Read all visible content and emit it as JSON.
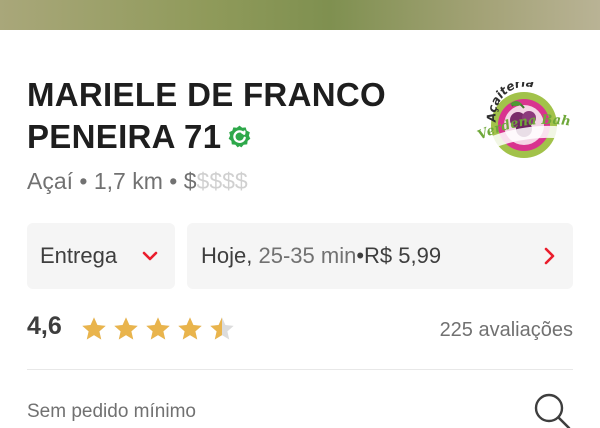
{
  "store": {
    "name_line1": "MARIELE DE FRANCO",
    "name_line2": "PENEIRA 71",
    "category": "Açaí",
    "separator": "•",
    "distance": "1,7 km",
    "price_active": "$",
    "price_inactive": "$$$$",
    "logo_text_top": "Açaiteria",
    "logo_text_bottom": "Verdena Bahia"
  },
  "delivery": {
    "mode_label": "Entrega",
    "day": "Hoje,",
    "time_range": "25-35 min",
    "separator": "•",
    "fee": "R$ 5,99"
  },
  "rating": {
    "value": "4,6",
    "stars_value": 4.6,
    "stars_max": 5,
    "reviews": "225 avaliações"
  },
  "footer": {
    "min_order": "Sem pedido mínimo"
  },
  "colors": {
    "verified_green": "#2ea84a",
    "star_gold": "#e9b44c",
    "star_empty": "#dcdcdc",
    "chevron_red": "#ea1d2c"
  }
}
